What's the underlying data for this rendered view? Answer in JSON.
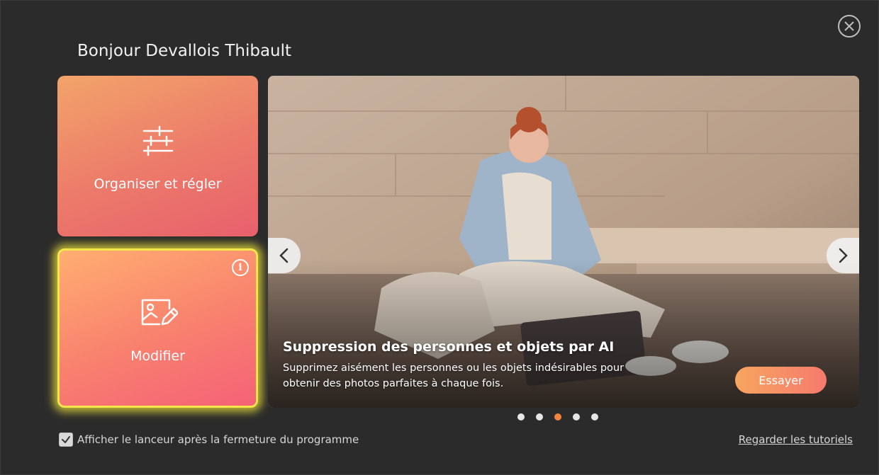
{
  "header": {
    "greeting": "Bonjour Devallois Thibault",
    "close_icon": "close-circle-icon"
  },
  "tiles": [
    {
      "label": "Organiser et régler",
      "icon": "sliders-icon"
    },
    {
      "label": "Modifier",
      "icon": "image-edit-icon",
      "info_icon": "info-icon"
    }
  ],
  "carousel": {
    "slide": {
      "title": "Suppression des personnes et objets par AI",
      "description": "Supprimez aisément les personnes ou les objets indésirables pour obtenir des photos parfaites à chaque fois.",
      "button_label": "Essayer"
    },
    "prev_icon": "chevron-left-icon",
    "next_icon": "chevron-right-icon",
    "dot_count": 5,
    "active_index": 2
  },
  "footer": {
    "checkbox_label": "Afficher le lanceur après la fermeture du programme",
    "checkbox_checked": true,
    "tutorial_link": "Regarder les tutoriels"
  },
  "colors": {
    "background": "#2b2b2b",
    "accent": "#f2843e",
    "highlight": "#f5e64a"
  }
}
